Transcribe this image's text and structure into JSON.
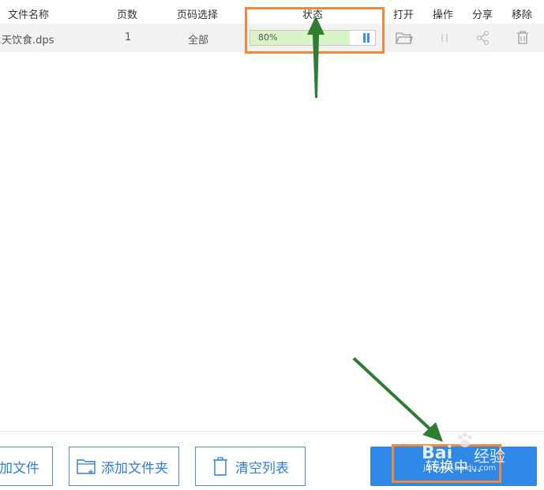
{
  "table": {
    "headers": {
      "file_name": "文件名称",
      "pages": "页数",
      "page_select": "页码选择",
      "status": "状态",
      "open": "打开",
      "operation": "操作",
      "share": "分享",
      "remove": "移除"
    },
    "rows": [
      {
        "file_name": "天饮食.dps",
        "pages": "1",
        "page_select": "全部",
        "progress_text": "80%",
        "progress_value": 0.8
      }
    ]
  },
  "icons": {
    "open": "folder-open-icon",
    "operation": "pause-icon",
    "share": "share-icon",
    "remove": "trash-icon",
    "status_pause": "pause-icon"
  },
  "footer": {
    "add_file_label": "加文件",
    "add_folder_label": "添加文件夹",
    "clear_list_label": "清空列表",
    "convert_label": "转换中..."
  },
  "watermark": {
    "brand": "Bai",
    "brand2": "经验",
    "url": "jingyan.baidu.com"
  },
  "colors": {
    "accent": "#2f87e8",
    "highlight": "#f08a3a",
    "arrow": "#2e7d32",
    "progress_fill": "#d8f5c7"
  }
}
